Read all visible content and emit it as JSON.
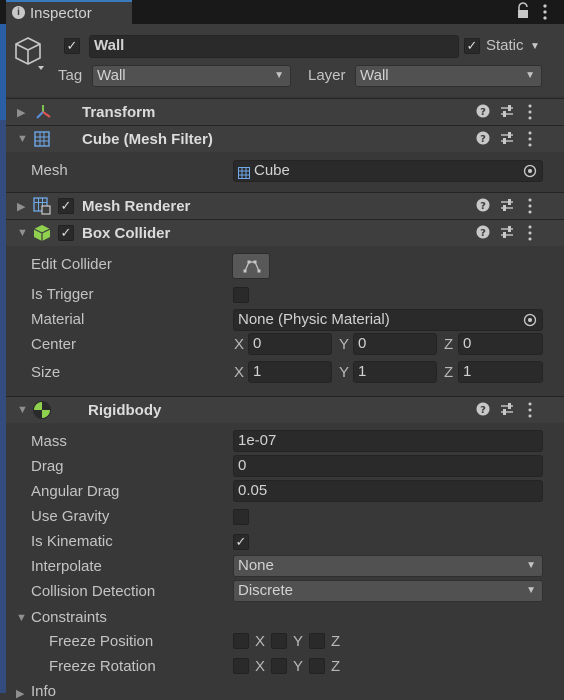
{
  "tab": {
    "title": "Inspector"
  },
  "object": {
    "active_checked": true,
    "name": "Wall",
    "static_checked": true,
    "static_label": "Static",
    "tag_label": "Tag",
    "tag_value": "Wall",
    "layer_label": "Layer",
    "layer_value": "Wall"
  },
  "transform": {
    "title": "Transform"
  },
  "mesh_filter": {
    "title": "Cube (Mesh Filter)",
    "mesh_label": "Mesh",
    "mesh_value": "Cube"
  },
  "mesh_renderer": {
    "title": "Mesh Renderer",
    "enabled": true
  },
  "box_collider": {
    "title": "Box Collider",
    "enabled": true,
    "edit_collider_label": "Edit Collider",
    "is_trigger_label": "Is Trigger",
    "is_trigger": false,
    "material_label": "Material",
    "material_value": "None (Physic Material)",
    "center_label": "Center",
    "center": {
      "x": "0",
      "y": "0",
      "z": "0"
    },
    "size_label": "Size",
    "size": {
      "x": "1",
      "y": "1",
      "z": "1"
    }
  },
  "rigidbody": {
    "title": "Rigidbody",
    "mass_label": "Mass",
    "mass": "1e-07",
    "drag_label": "Drag",
    "drag": "0",
    "angular_drag_label": "Angular Drag",
    "angular_drag": "0.05",
    "use_gravity_label": "Use Gravity",
    "use_gravity": false,
    "is_kinematic_label": "Is Kinematic",
    "is_kinematic": true,
    "interpolate_label": "Interpolate",
    "interpolate": "None",
    "collision_detection_label": "Collision Detection",
    "collision_detection": "Discrete",
    "constraints_label": "Constraints",
    "freeze_position_label": "Freeze Position",
    "freeze_rotation_label": "Freeze Rotation"
  },
  "axis_labels": {
    "x": "X",
    "y": "Y",
    "z": "Z"
  },
  "info": {
    "label": "Info"
  },
  "icons": {
    "help": "help-icon",
    "presets": "presets-icon",
    "more": "more-icon",
    "lock": "lock-icon",
    "menu": "kebab-menu-icon"
  },
  "colors": {
    "background": "#383838",
    "header": "#3e3e3e",
    "tabbar": "#191919",
    "accent": "#3a79bb"
  }
}
